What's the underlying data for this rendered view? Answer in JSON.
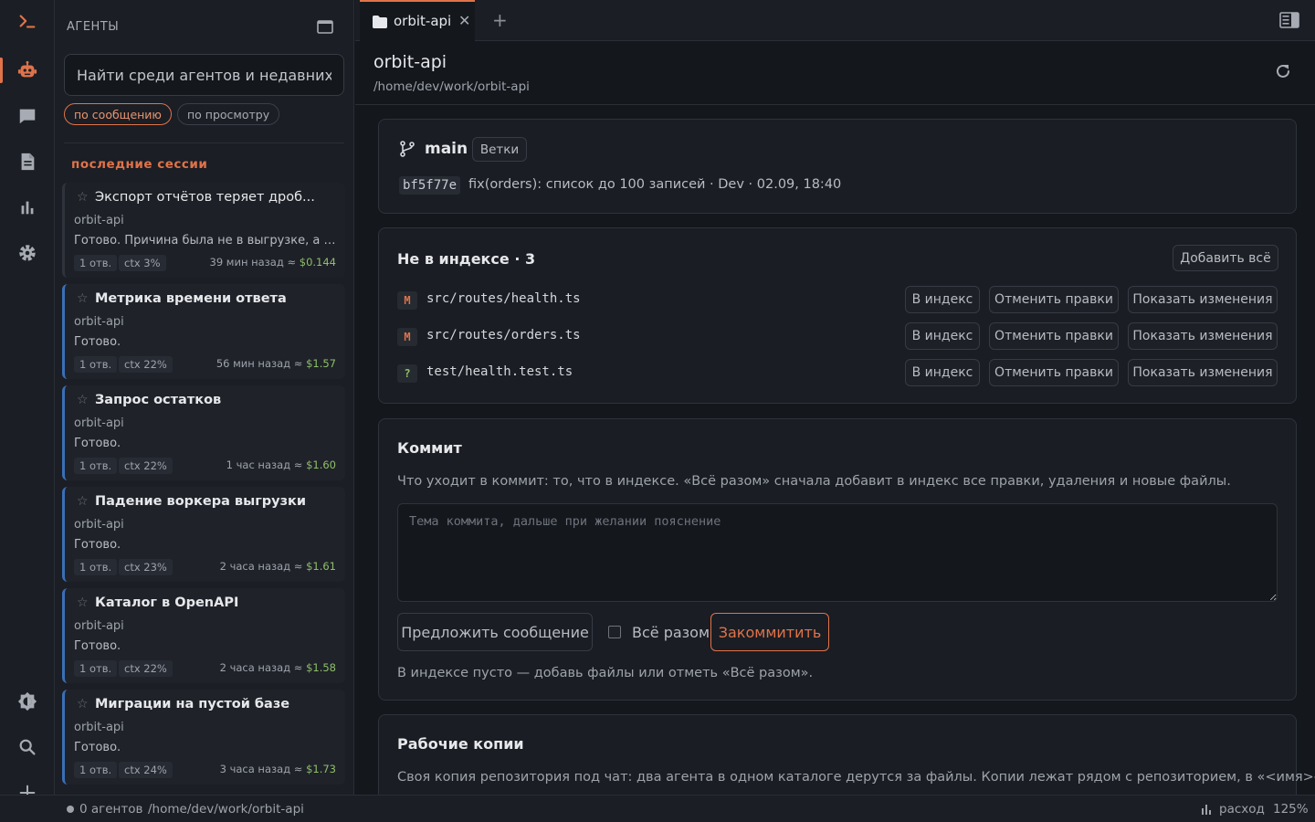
{
  "sidebar": {
    "title": "АГЕНТЫ",
    "search_placeholder": "Найти среди агентов и недавних",
    "filters": [
      "по сообщению",
      "по просмотру"
    ],
    "section_title": "последние сессии",
    "sessions": [
      {
        "title": "Экспорт отчётов теряет дроб...",
        "project": "orbit-api",
        "result": "Готово. Причина была не в выгрузке, а в ти...",
        "replies": "1 отв.",
        "ctx": "ctx 3%",
        "when": "39 мин назад ≈",
        "cost": "$0.144"
      },
      {
        "title": "Метрика времени ответа",
        "project": "orbit-api",
        "result": "Готово.",
        "replies": "1 отв.",
        "ctx": "ctx 22%",
        "when": "56 мин назад ≈",
        "cost": "$1.57"
      },
      {
        "title": "Запрос остатков",
        "project": "orbit-api",
        "result": "Готово.",
        "replies": "1 отв.",
        "ctx": "ctx 22%",
        "when": "1 час назад ≈",
        "cost": "$1.60"
      },
      {
        "title": "Падение воркера выгрузки",
        "project": "orbit-api",
        "result": "Готово.",
        "replies": "1 отв.",
        "ctx": "ctx 23%",
        "when": "2 часа назад ≈",
        "cost": "$1.61"
      },
      {
        "title": "Каталог в OpenAPI",
        "project": "orbit-api",
        "result": "Готово.",
        "replies": "1 отв.",
        "ctx": "ctx 22%",
        "when": "2 часа назад ≈",
        "cost": "$1.58"
      },
      {
        "title": "Миграции на пустой базе",
        "project": "orbit-api",
        "result": "Готово.",
        "replies": "1 отв.",
        "ctx": "ctx 24%",
        "when": "3 часа назад ≈",
        "cost": "$1.73"
      }
    ]
  },
  "tabs": {
    "active": "orbit-api",
    "close": "✕",
    "plus": "+"
  },
  "header": {
    "title": "orbit-api",
    "path": "/home/dev/work/orbit-api"
  },
  "branch": {
    "name": "main",
    "branches_label": "Ветки",
    "hash": "bf5f77e",
    "message": "fix(orders): список до 100 записей · Dev · 02.09, 18:40"
  },
  "unstaged": {
    "title": "Не в индексе · 3",
    "add_all": "Добавить всё",
    "files": [
      {
        "status": "M",
        "path": "src/routes/health.ts"
      },
      {
        "status": "M",
        "path": "src/routes/orders.ts"
      },
      {
        "status": "?",
        "path": "test/health.test.ts"
      }
    ],
    "stage_label": "В индекс",
    "revert_label": "Отменить правки",
    "diff_label": "Показать изменения"
  },
  "commit": {
    "title": "Коммит",
    "description": "Что уходит в коммит: то, что в индексе. «Всё разом» сначала добавит в индекс все правки, удаления и новые файлы.",
    "placeholder": "Тема коммита, дальше при желании пояснение",
    "suggest": "Предложить сообщение",
    "all_at_once": "Всё разом",
    "commit_btn": "Закоммитить",
    "note": "В индексе пусто — добавь файлы или отметь «Всё разом»."
  },
  "worktrees": {
    "title": "Рабочие копии",
    "description": "Своя копия репозитория под чат: два агента в одном каталоге дерутся за файлы. Копии лежат рядом с репозиторием, в «<имя>-"
  },
  "status": {
    "agents": "0 агентов",
    "path": "/home/dev/work/orbit-api",
    "spend": "расход",
    "zoom": "125%"
  },
  "colors": {
    "accent": "#e0734a",
    "session_border": "#3b6fb6",
    "cost": "#8fbf6a"
  }
}
